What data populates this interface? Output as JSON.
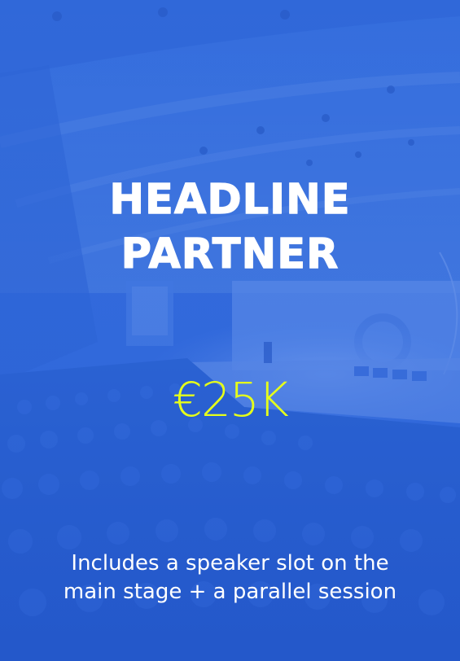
{
  "card": {
    "headline_line1": "HEADLINE",
    "headline_line2": "PARTNER",
    "price": "€25K",
    "description_line1": "Includes a speaker slot on the",
    "description_line2": "main stage + a parallel session"
  },
  "colors": {
    "overlay_blue": "#2f6de0",
    "price_yellow": "#e6ff1a",
    "text_white": "#ffffff"
  },
  "background": {
    "icon": "conference-hall-photo"
  }
}
